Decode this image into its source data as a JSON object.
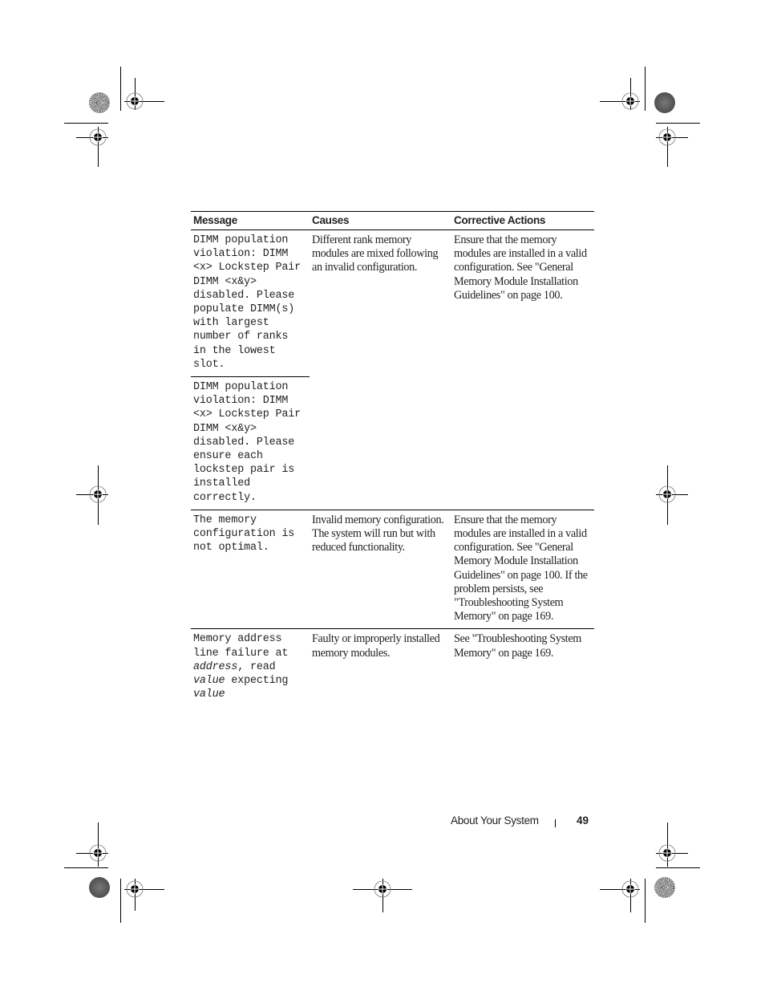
{
  "table": {
    "headers": [
      "Message",
      "Causes",
      "Corrective Actions"
    ],
    "rows": [
      {
        "message": "DIMM population\nviolation: DIMM\n<x> Lockstep Pair\nDIMM <x&y>\ndisabled. Please\npopulate DIMM(s)\nwith largest\nnumber of ranks\nin the lowest\nslot.",
        "cause": "Different rank memory modules are mixed following an invalid configuration.",
        "action": "Ensure that the memory modules are installed in a valid configuration. See \"General Memory Module Installation Guidelines\" on page 100."
      },
      {
        "message": "DIMM population\nviolation: DIMM\n<x> Lockstep Pair\nDIMM <x&y>\ndisabled. Please\nensure each\nlockstep pair is\ninstalled\ncorrectly.",
        "cause": "",
        "action": ""
      },
      {
        "message": "The memory\nconfiguration is\nnot optimal.",
        "cause": "Invalid memory configuration. The system will run but with reduced functionality.",
        "action": "Ensure that the memory modules are installed in a valid configuration. See \"General Memory Module Installation Guidelines\" on page 100. If the problem persists, see \"Troubleshooting System Memory\" on page 169."
      },
      {
        "message_parts": {
          "line1": "Memory address",
          "line2": "line failure at",
          "var_address": "address",
          "line3_rest": ", read",
          "var_value1": "value",
          "line4_rest": " expecting",
          "var_value2": "value"
        },
        "cause": "Faulty or improperly installed memory modules.",
        "action": "See \"Troubleshooting System Memory\" on page 169."
      }
    ]
  },
  "footer": {
    "section_title": "About Your System",
    "page_number": "49"
  },
  "marks": {
    "registration_target_icon": "crosshair-target",
    "color_disc_icons": [
      "starburst-disc",
      "speckle-disc"
    ]
  }
}
